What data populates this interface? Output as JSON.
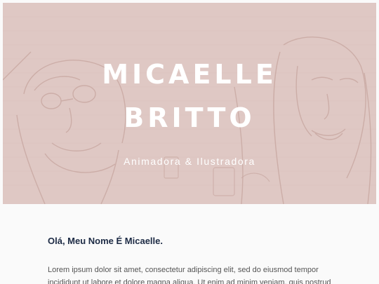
{
  "hero": {
    "title_line1": "MICAELLE",
    "title_line2": "BRITTO",
    "subtitle": "Animadora & Ilustradora",
    "background_color": "#dfc8c4"
  },
  "about": {
    "heading": "Olá, Meu Nome É Micaelle.",
    "body": "Lorem ipsum dolor sit amet, consectetur adipiscing elit, sed do eiusmod tempor incididunt ut labore et dolore magna aliqua. Ut enim ad minim veniam, quis nostrud"
  }
}
